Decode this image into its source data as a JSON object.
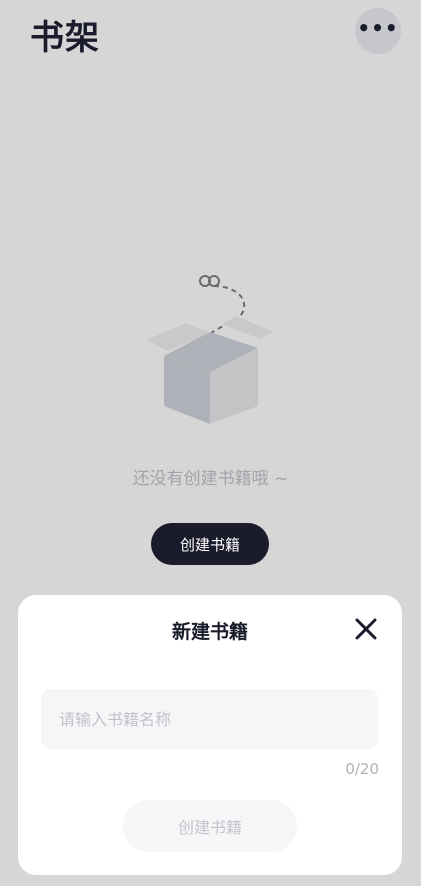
{
  "header": {
    "title": "书架",
    "more_label": "•••"
  },
  "empty_state": {
    "text": "还没有创建书籍哦 ~",
    "create_label": "创建书籍",
    "illustration_icon": "empty-box-icon"
  },
  "sheet": {
    "title": "新建书籍",
    "close_icon": "close-icon",
    "name_input": {
      "value": "",
      "placeholder": "请输入书籍名称"
    },
    "counter": "0/20",
    "create_label": "创建书籍"
  },
  "colors": {
    "dark": "#1b1c2b",
    "overlay": "#d6d6d6",
    "input_bg": "#f5f6f8",
    "muted": "#a3a4aa"
  }
}
